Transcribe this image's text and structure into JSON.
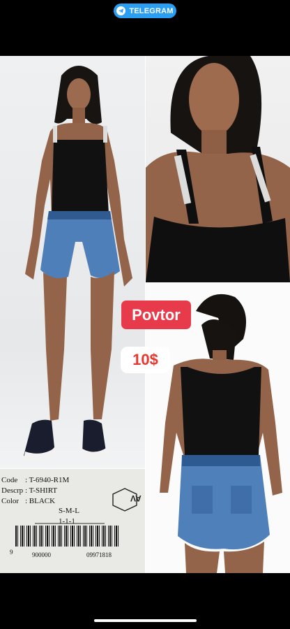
{
  "telegram_badge": {
    "label": "TELEGRAM",
    "color": "#2a9ef2"
  },
  "brand_label": "Povtor",
  "price": "10$",
  "accent_colors": {
    "brand": "#e73a4a",
    "price": "#e8382e"
  },
  "product_tag": {
    "rows": [
      {
        "key": "Code",
        "value": ": T-6940-R1M"
      },
      {
        "key": "Descrp",
        "value": ": T-SHIRT"
      },
      {
        "key": "Color",
        "value": ": BLACK"
      }
    ],
    "size": "S-M-L",
    "ratio": "1-1-1",
    "barcode_left": "9",
    "barcode_mid": "900000",
    "barcode_right": "09971818",
    "logo": "AV"
  }
}
